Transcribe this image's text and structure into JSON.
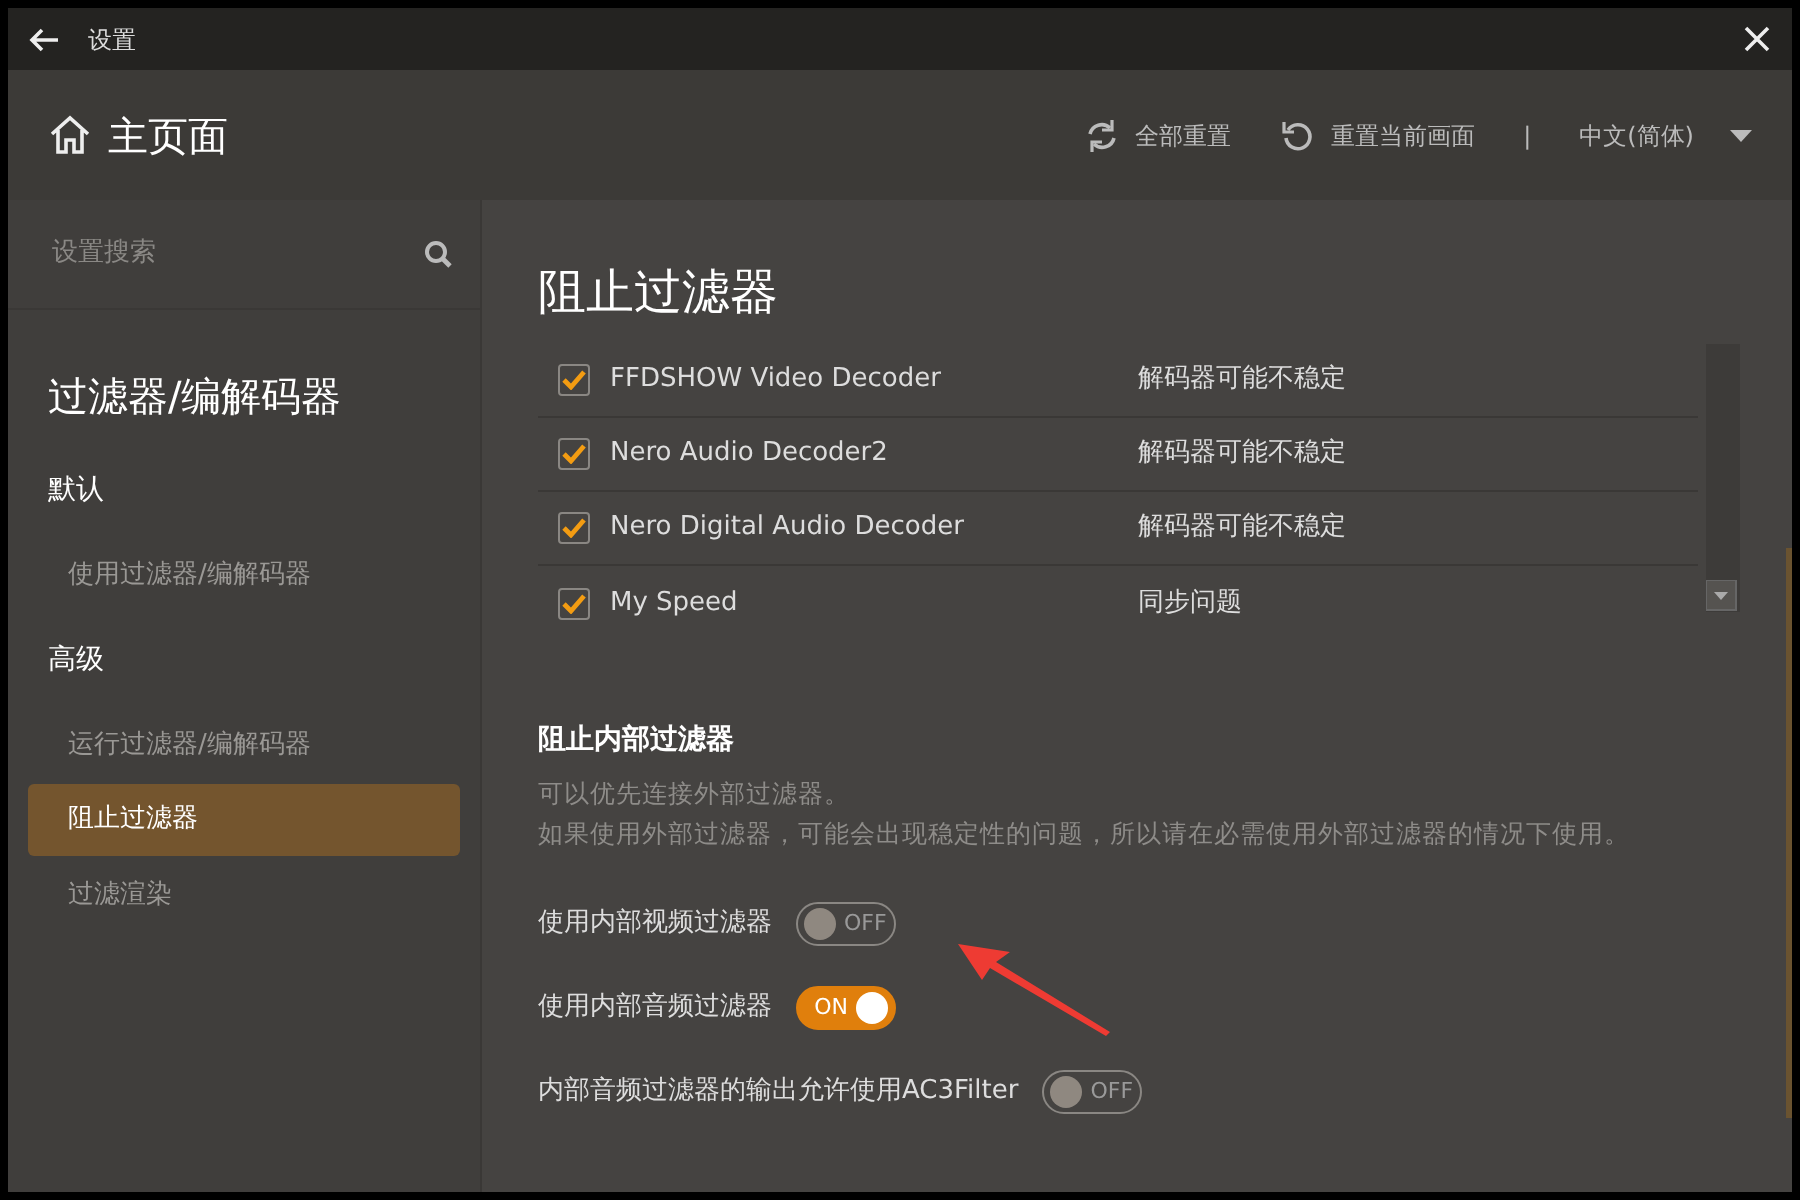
{
  "window": {
    "title": "设置"
  },
  "header": {
    "title": "主页面",
    "actions": [
      {
        "kind": "reset-all",
        "label": "全部重置"
      },
      {
        "kind": "reset-current",
        "label": "重置当前画面"
      }
    ],
    "separator": "|",
    "language": "中文(简体)"
  },
  "sidebar": {
    "search": {
      "placeholder": "设置搜索"
    },
    "items": [
      {
        "kind": "heading",
        "label": "过滤器/编解码器"
      },
      {
        "kind": "section",
        "label": "默认"
      },
      {
        "kind": "item",
        "label": "使用过滤器/编解码器",
        "selected": false
      },
      {
        "kind": "section",
        "label": "高级"
      },
      {
        "kind": "item",
        "label": "运行过滤器/编解码器",
        "selected": false
      },
      {
        "kind": "item",
        "label": "阻止过滤器",
        "selected": true
      },
      {
        "kind": "item",
        "label": "过滤渲染",
        "selected": false
      }
    ]
  },
  "content": {
    "title": "阻止过滤器",
    "filters": [
      {
        "name": "FFDSHOW Video Decoder",
        "reason": "解码器可能不稳定",
        "checked": true
      },
      {
        "name": "Nero Audio Decoder2",
        "reason": "解码器可能不稳定",
        "checked": true
      },
      {
        "name": "Nero Digital Audio Decoder",
        "reason": "解码器可能不稳定",
        "checked": true
      },
      {
        "name": "My Speed",
        "reason": "同步问题",
        "checked": true
      }
    ],
    "section_title": "阻止内部过滤器",
    "description_lines": [
      "可以优先连接外部过滤器。",
      "如果使用外部过滤器，可能会出现稳定性的问题，所以请在必需使用外部过滤器的情况下使用。"
    ],
    "toggles": [
      {
        "label": "使用内部视频过滤器",
        "on": false,
        "state_text": "OFF"
      },
      {
        "label": "使用内部音频过滤器",
        "on": true,
        "state_text": "ON"
      },
      {
        "label": "内部音频过滤器的输出允许使用AC3Filter",
        "on": false,
        "state_text": "OFF"
      }
    ]
  }
}
